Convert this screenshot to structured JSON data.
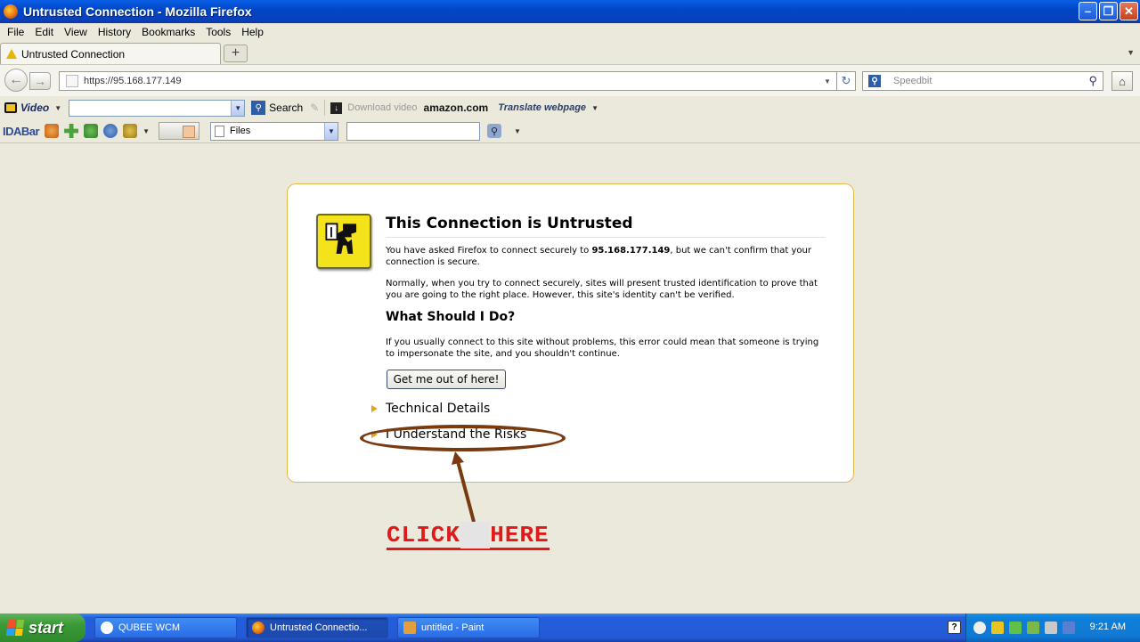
{
  "window": {
    "title": "Untrusted Connection - Mozilla Firefox"
  },
  "menu": [
    "File",
    "Edit",
    "View",
    "History",
    "Bookmarks",
    "Tools",
    "Help"
  ],
  "tab": {
    "label": "Untrusted Connection",
    "new_tab": "+"
  },
  "nav": {
    "url": "https://95.168.177.149",
    "search_placeholder": "Speedbit"
  },
  "toolbar1": {
    "video_label": "Video",
    "search_label": "Search",
    "download_label": "Download video",
    "amazon_label": "amazon.com",
    "translate_label": "Translate webpage"
  },
  "toolbar2": {
    "brand": "IDABar",
    "files_select": "Files"
  },
  "error": {
    "title": "This Connection is Untrusted",
    "p1_before": "You have asked Firefox to connect securely to ",
    "p1_host": "95.168.177.149",
    "p1_after": ", but we can't confirm that your connection is secure.",
    "p2": "Normally, when you try to connect securely, sites will present trusted identification to prove that you are going to the right place. However, this site's identity can't be verified.",
    "what_heading": "What Should I Do?",
    "p3": "If you usually connect to this site without problems, this error could mean that someone is trying to impersonate the site, and you shouldn't continue.",
    "get_out_button": "Get me out of here!",
    "technical_details": "Technical Details",
    "understand_risks": "I Understand the Risks"
  },
  "annotation": {
    "click_here_1": "CLICK",
    "click_here_2": "HERE"
  },
  "taskbar": {
    "start": "start",
    "items": [
      "QUBEE WCM",
      "Untrusted Connectio...",
      "untitled - Paint"
    ],
    "clock": "9:21 AM"
  },
  "colors": {
    "titlebar": "#0047c8",
    "error_border": "#e6b94b",
    "annotation_red": "#e01a1a",
    "annotation_brown": "#7a3a10"
  }
}
